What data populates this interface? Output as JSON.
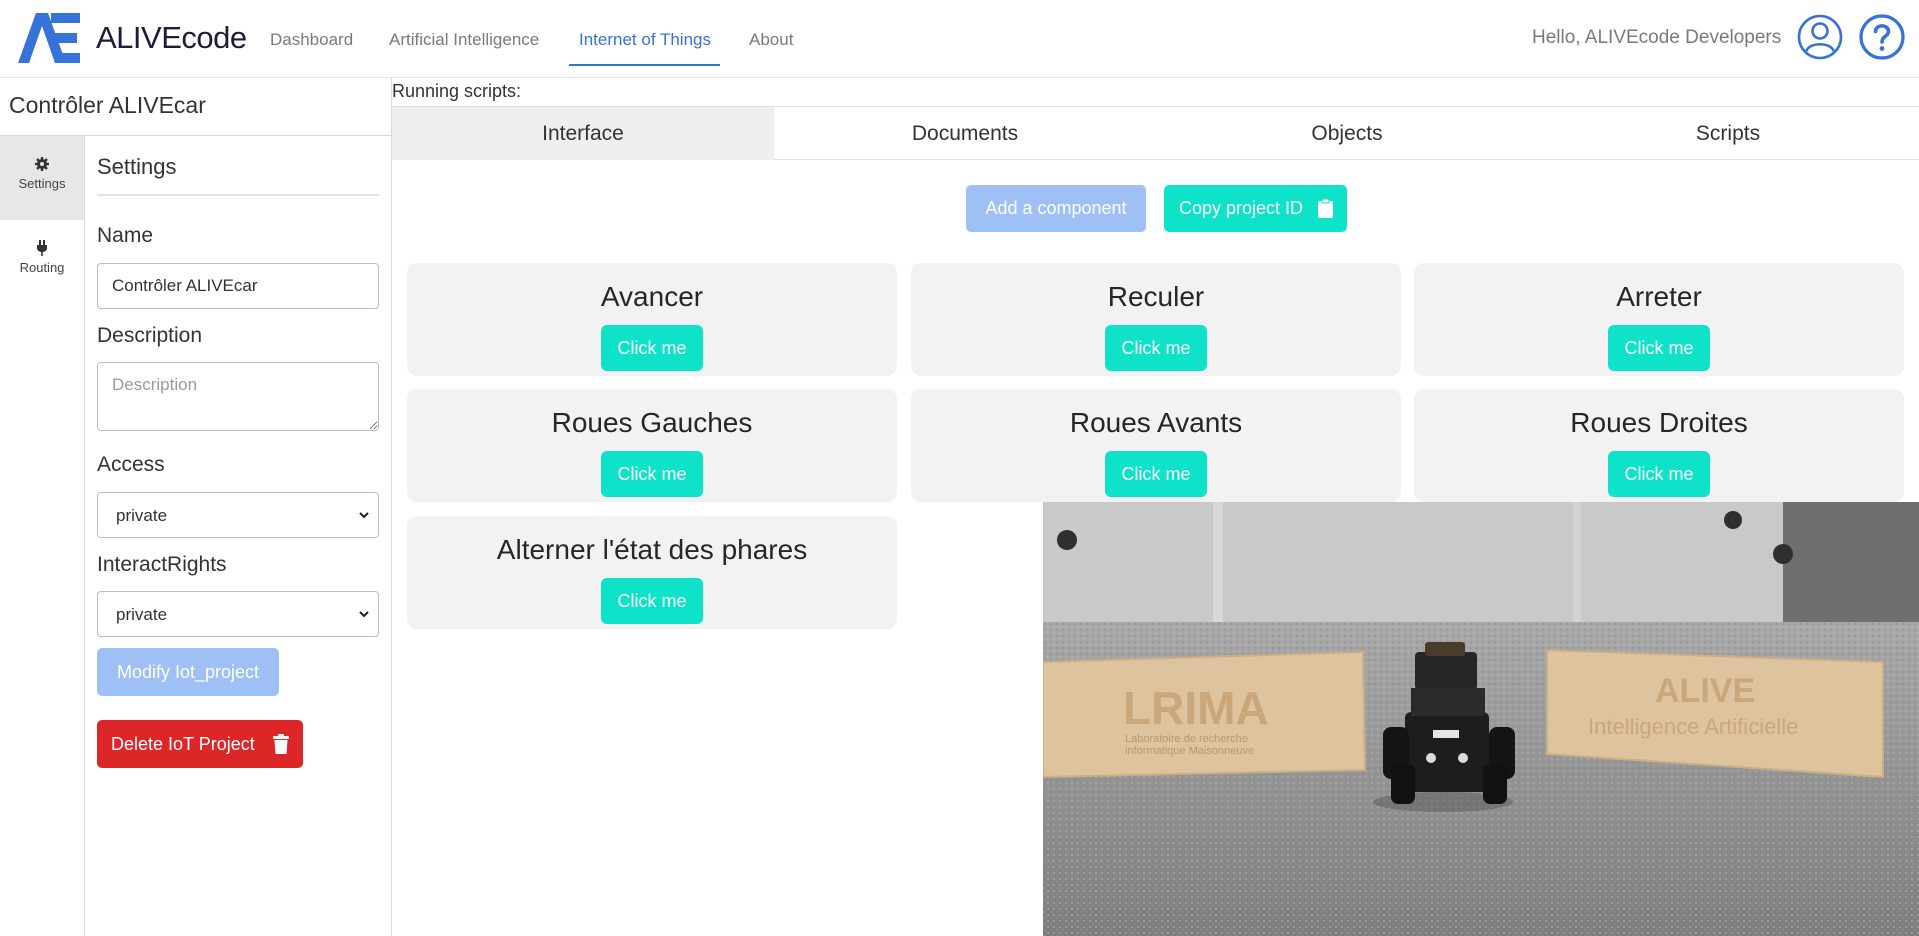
{
  "brand": "ALIVEcode",
  "nav": {
    "links": [
      {
        "label": "Dashboard"
      },
      {
        "label": "Artificial Intelligence"
      },
      {
        "label": "Internet of Things"
      },
      {
        "label": "About"
      }
    ],
    "greeting": "Hello, ALIVEcode Developers"
  },
  "project": {
    "title": "Contrôler ALIVEcar"
  },
  "side_tabs": [
    {
      "label": "Settings",
      "icon": "gear-icon"
    },
    {
      "label": "Routing",
      "icon": "plug-icon"
    }
  ],
  "settings": {
    "heading": "Settings",
    "name_label": "Name",
    "name_value": "Contrôler ALIVEcar",
    "description_label": "Description",
    "description_placeholder": "Description",
    "access_label": "Access",
    "access_value": "private",
    "interact_label": "InteractRights",
    "interact_value": "private",
    "modify_label": "Modify Iot_project",
    "delete_label": "Delete IoT Project"
  },
  "main": {
    "running_scripts": "Running scripts:",
    "tabs": [
      {
        "label": "Interface"
      },
      {
        "label": "Documents"
      },
      {
        "label": "Objects"
      },
      {
        "label": "Scripts"
      }
    ],
    "add_component_label": "Add a component",
    "copy_id_label": "Copy project ID",
    "components": [
      {
        "title": "Avancer",
        "button": "Click me"
      },
      {
        "title": "Reculer",
        "button": "Click me"
      },
      {
        "title": "Arreter",
        "button": "Click me"
      },
      {
        "title": "Roues Gauches",
        "button": "Click me"
      },
      {
        "title": "Roues Avants",
        "button": "Click me"
      },
      {
        "title": "Roues Droites",
        "button": "Click me"
      },
      {
        "title": "Alterner l'état des phares",
        "button": "Click me"
      }
    ]
  },
  "video": {
    "sign_left": "LRIMA",
    "sign_left_sub1": "Laboratoire de recherche",
    "sign_left_sub2": "informatique Maisonneuve",
    "sign_right": "ALIVE",
    "sign_right_sub": "Intelligence Artificielle"
  },
  "colors": {
    "accent_blue": "#3772d8",
    "teal_button": "#0ee3c9",
    "disabled_blue": "#9ec0f5",
    "danger": "#dd2627"
  }
}
